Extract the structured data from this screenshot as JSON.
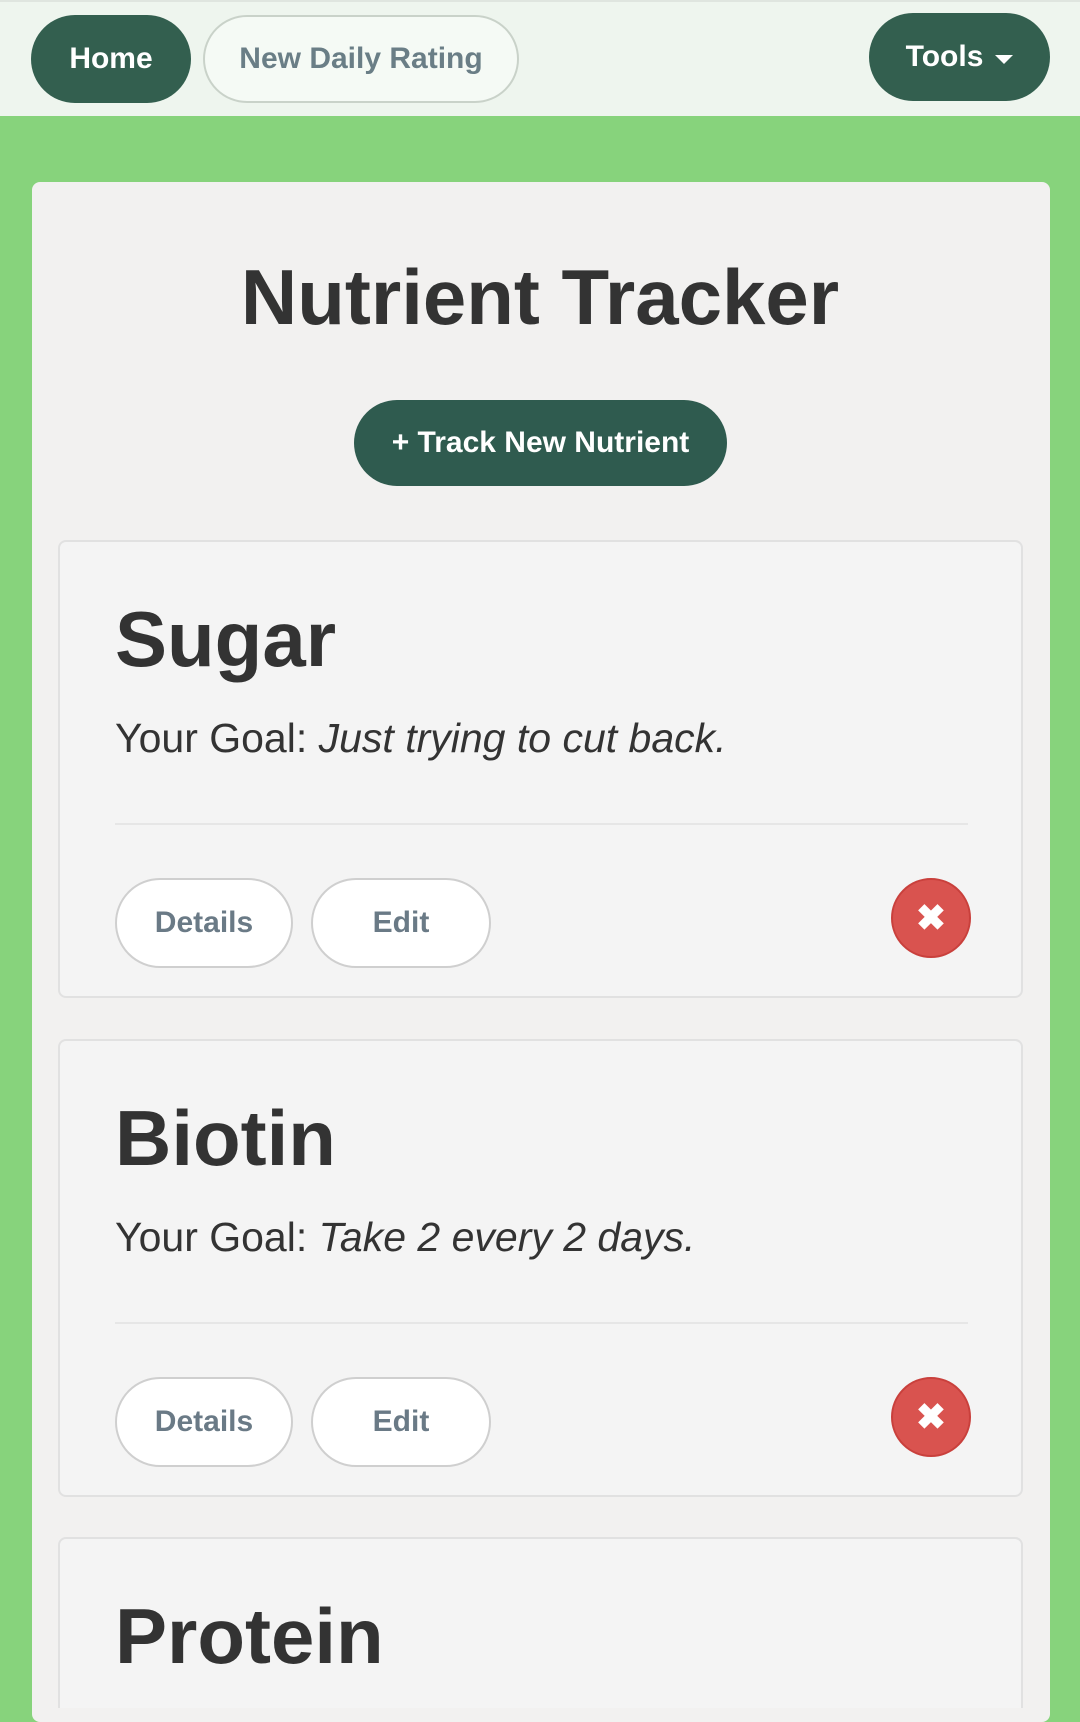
{
  "nav": {
    "home_label": "Home",
    "rating_label": "New Daily Rating",
    "tools_label": "Tools"
  },
  "main": {
    "title": "Nutrient Tracker",
    "track_button_label": "+ Track New Nutrient"
  },
  "goal_prefix": "Your Goal: ",
  "nutrients": [
    {
      "name": "Sugar",
      "goal": "Just trying to cut back.",
      "details_label": "Details",
      "edit_label": "Edit",
      "delete_icon": "close-icon"
    },
    {
      "name": "Biotin",
      "goal": "Take 2 every 2 days.",
      "details_label": "Details",
      "edit_label": "Edit",
      "delete_icon": "close-icon"
    },
    {
      "name": "Protein"
    }
  ],
  "colors": {
    "background": "#87d37c",
    "primary": "#335f4f",
    "danger": "#d9534f"
  }
}
